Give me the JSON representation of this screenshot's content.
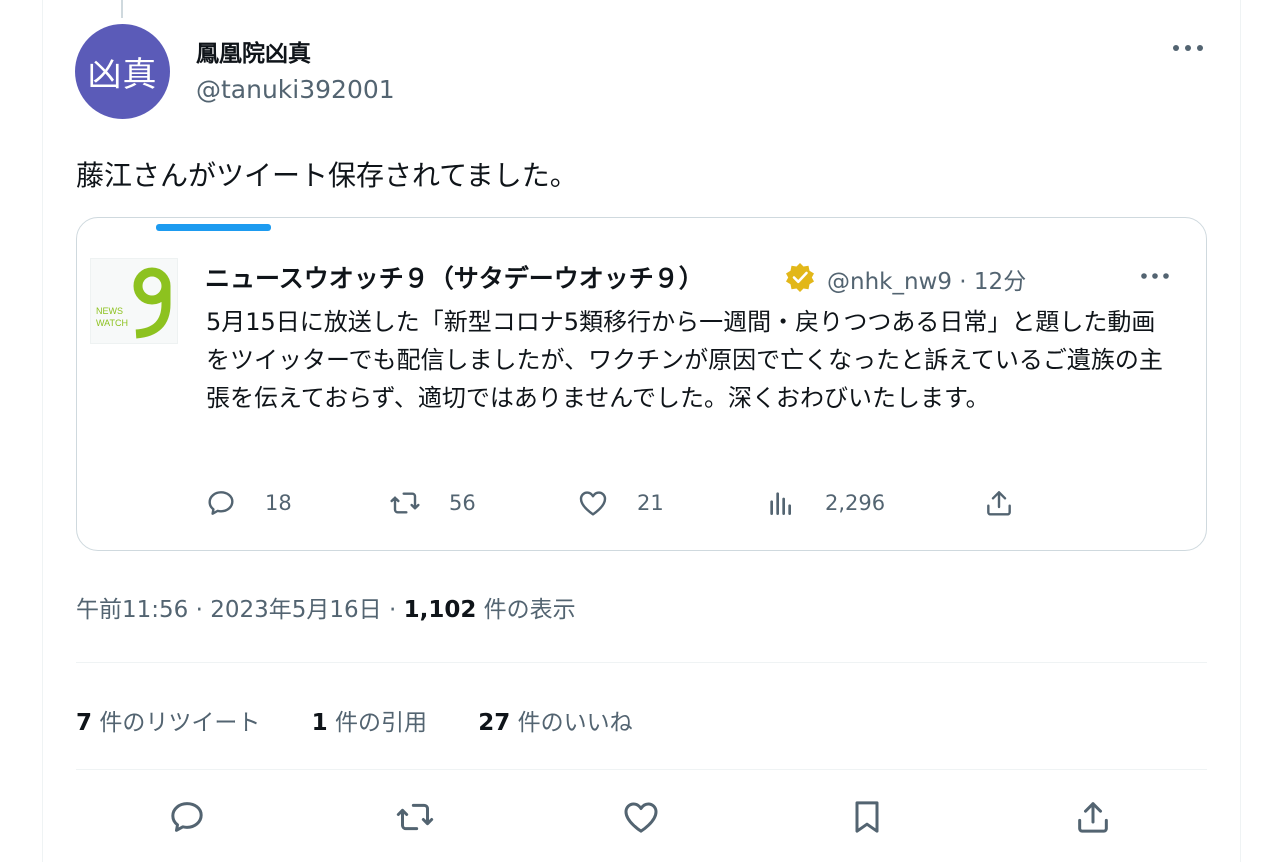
{
  "author": {
    "avatar_text": "凶真",
    "display_name": "鳳凰院凶真",
    "handle": "@tanuki392001"
  },
  "tweet": {
    "text": "藤江さんがツイート保存されてました。"
  },
  "quote": {
    "logo_text": "NEWS WATCH",
    "display_name": "ニュースウオッチ９（サタデーウオッチ９）",
    "meta": "@nhk_nw9 · 12分",
    "text": "5月15日に放送した「新型コロナ5類移行から一週間・戻りつつある日常」と題した動画をツイッターでも配信しましたが、ワクチンが原因で亡くなったと訴えているご遺族の主張を伝えておらず、適切ではありませんでした。深くおわびいたします。",
    "replies": "18",
    "retweets": "56",
    "likes": "21",
    "views": "2,296"
  },
  "timestamp": {
    "time_date": "午前11:56 · 2023年5月16日 · ",
    "views_count": "1,102",
    "views_label": " 件の表示"
  },
  "stats": {
    "retweets_count": "7",
    "retweets_label": " 件のリツイート",
    "quotes_count": "1",
    "quotes_label": " 件の引用",
    "likes_count": "27",
    "likes_label": " 件のいいね"
  },
  "colors": {
    "avatar_bg": "#5b5bb8",
    "accent": "#1d9bf0",
    "verified_gold": "#e2b719",
    "logo_green": "#8dc21f",
    "secondary_text": "#536471"
  },
  "icons": [
    "more-icon",
    "verified-icon",
    "reply-icon",
    "retweet-icon",
    "like-icon",
    "views-icon",
    "share-icon",
    "bookmark-icon"
  ]
}
